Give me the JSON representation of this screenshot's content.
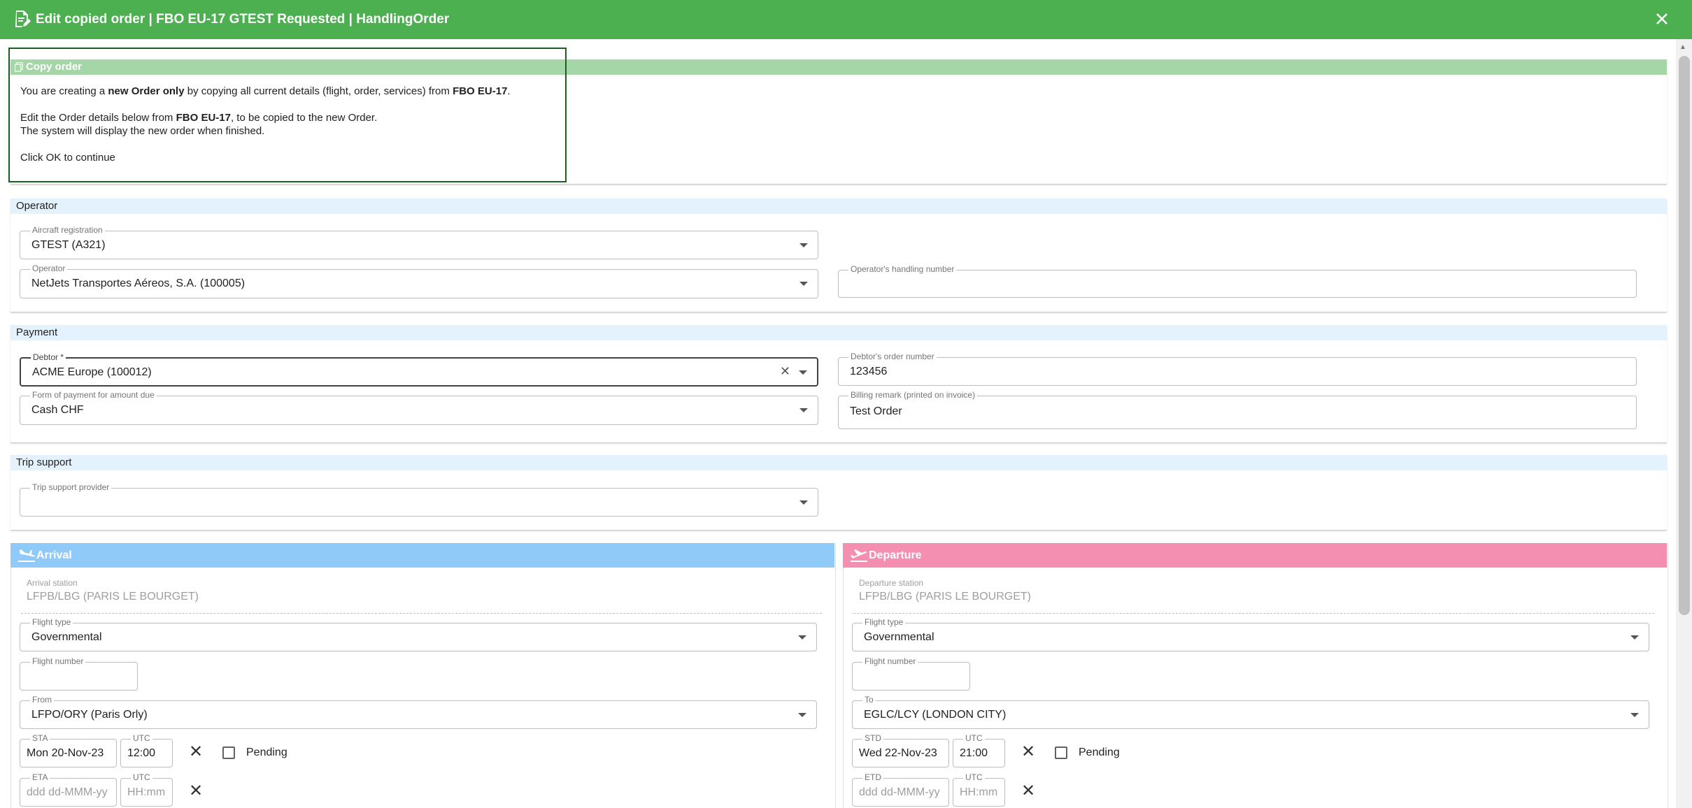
{
  "header": {
    "title": "Edit copied order | FBO EU-17 GTEST Requested | HandlingOrder",
    "doc_icon": "edit-document-icon",
    "close_icon": "close-icon"
  },
  "copy_notice": {
    "heading": "Copy order",
    "line1_pre": "You are creating a ",
    "line1_bold": "new Order only",
    "line1_mid": " by copying all current details (flight, order, services) from ",
    "line1_ref": "FBO EU-17",
    "line1_end": ".",
    "line2_pre": "Edit the Order details below from ",
    "line2_ref": "FBO EU-17",
    "line2_end": ", to be copied to the new Order.",
    "line3": "The system will display the new order when finished.",
    "line4": "Click OK to continue"
  },
  "operator": {
    "heading": "Operator",
    "aircraft_label": "Aircraft registration",
    "aircraft_value": "GTEST (A321)",
    "operator_label": "Operator",
    "operator_value": "NetJets Transportes Aéreos, S.A. (100005)",
    "handling_label": "Operator's handling number",
    "handling_value": ""
  },
  "payment": {
    "heading": "Payment",
    "debtor_label": "Debtor *",
    "debtor_value": "ACME Europe (100012)",
    "order_number_label": "Debtor's order number",
    "order_number_value": "123456",
    "form_label": "Form of payment for amount due",
    "form_value": "Cash CHF",
    "billing_label": "Billing remark (printed on invoice)",
    "billing_value": "Test Order"
  },
  "trip_support": {
    "heading": "Trip support",
    "provider_label": "Trip support provider",
    "provider_value": ""
  },
  "arrival": {
    "heading": "Arrival",
    "color": "#90caf9",
    "station_label": "Arrival station",
    "station_value": "LFPB/LBG (PARIS LE BOURGET)",
    "flight_type_label": "Flight type",
    "flight_type_value": "Governmental",
    "flight_number_label": "Flight number",
    "flight_number_value": "",
    "from_label": "From",
    "from_value": "LFPO/ORY (Paris Orly)",
    "sta_label": "STA",
    "sta_value": "Mon 20-Nov-23",
    "sta_utc_label": "UTC",
    "sta_utc_value": "12:00",
    "pending_label": "Pending",
    "eta_label": "ETA",
    "eta_placeholder": "ddd dd-MMM-yy",
    "eta_utc_label": "UTC",
    "eta_utc_placeholder": "HH:mm"
  },
  "departure": {
    "heading": "Departure",
    "color": "#f48fb1",
    "station_label": "Departure station",
    "station_value": "LFPB/LBG (PARIS LE BOURGET)",
    "flight_type_label": "Flight type",
    "flight_type_value": "Governmental",
    "flight_number_label": "Flight number",
    "flight_number_value": "",
    "to_label": "To",
    "to_value": "EGLC/LCY (LONDON CITY)",
    "std_label": "STD",
    "std_value": "Wed 22-Nov-23",
    "std_utc_label": "UTC",
    "std_utc_value": "21:00",
    "pending_label": "Pending",
    "etd_label": "ETD",
    "etd_placeholder": "ddd dd-MMM-yy",
    "etd_utc_label": "UTC",
    "etd_utc_placeholder": "HH:mm"
  }
}
